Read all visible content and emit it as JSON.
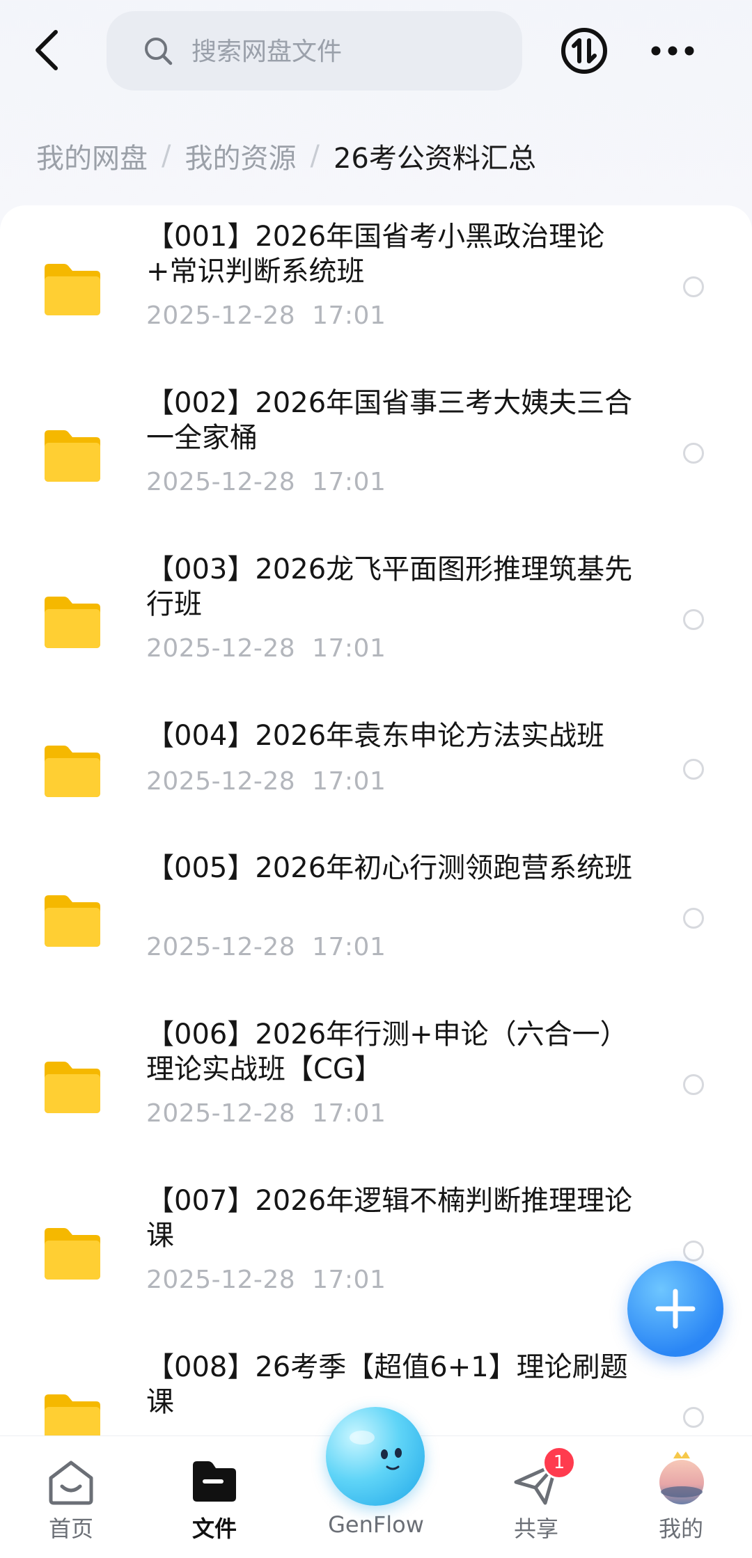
{
  "topbar": {
    "search_placeholder": "搜索网盘文件",
    "back_icon": "chevron-left-icon",
    "transfer_icon": "transfer-icon",
    "more_icon": "more-dots-icon"
  },
  "breadcrumb": {
    "items": [
      "我的网盘",
      "我的资源",
      "26考公资料汇总"
    ],
    "separator": "/"
  },
  "files": [
    {
      "name": "【001】2026年国省考小黑政治理论+常识判断系统班",
      "date": "2025-12-28  17:01"
    },
    {
      "name": "【002】2026年国省事三考大姨夫三合一全家桶",
      "date": "2025-12-28  17:01"
    },
    {
      "name": "【003】2026龙飞平面图形推理筑基先行班",
      "date": "2025-12-28  17:01"
    },
    {
      "name": "【004】2026年袁东申论方法实战班",
      "date": "2025-12-28  17:01"
    },
    {
      "name": "【005】2026年初心行测领跑营系统班",
      "date": "2025-12-28  17:01"
    },
    {
      "name": "【006】2026年行测+申论（六合一）理论实战班【CG】",
      "date": "2025-12-28  17:01"
    },
    {
      "name": "【007】2026年逻辑不楠判断推理理论课",
      "date": "2025-12-28  17:01"
    },
    {
      "name": "【008】26考季【超值6+1】理论刷题课",
      "date": ""
    }
  ],
  "fab": {
    "icon": "plus-icon"
  },
  "bottom_nav": {
    "items": [
      {
        "label": "首页",
        "icon": "home-icon",
        "active": false
      },
      {
        "label": "文件",
        "icon": "folder-icon",
        "active": true
      },
      {
        "label": "GenFlow",
        "icon": "genflow-orb-icon",
        "active": false
      },
      {
        "label": "共享",
        "icon": "share-icon",
        "active": false,
        "badge": "1"
      },
      {
        "label": "我的",
        "icon": "avatar-icon",
        "active": false
      }
    ]
  },
  "colors": {
    "accent": "#2a86f5",
    "folder": "#ffcb2f",
    "badge": "#ff3b4e"
  }
}
